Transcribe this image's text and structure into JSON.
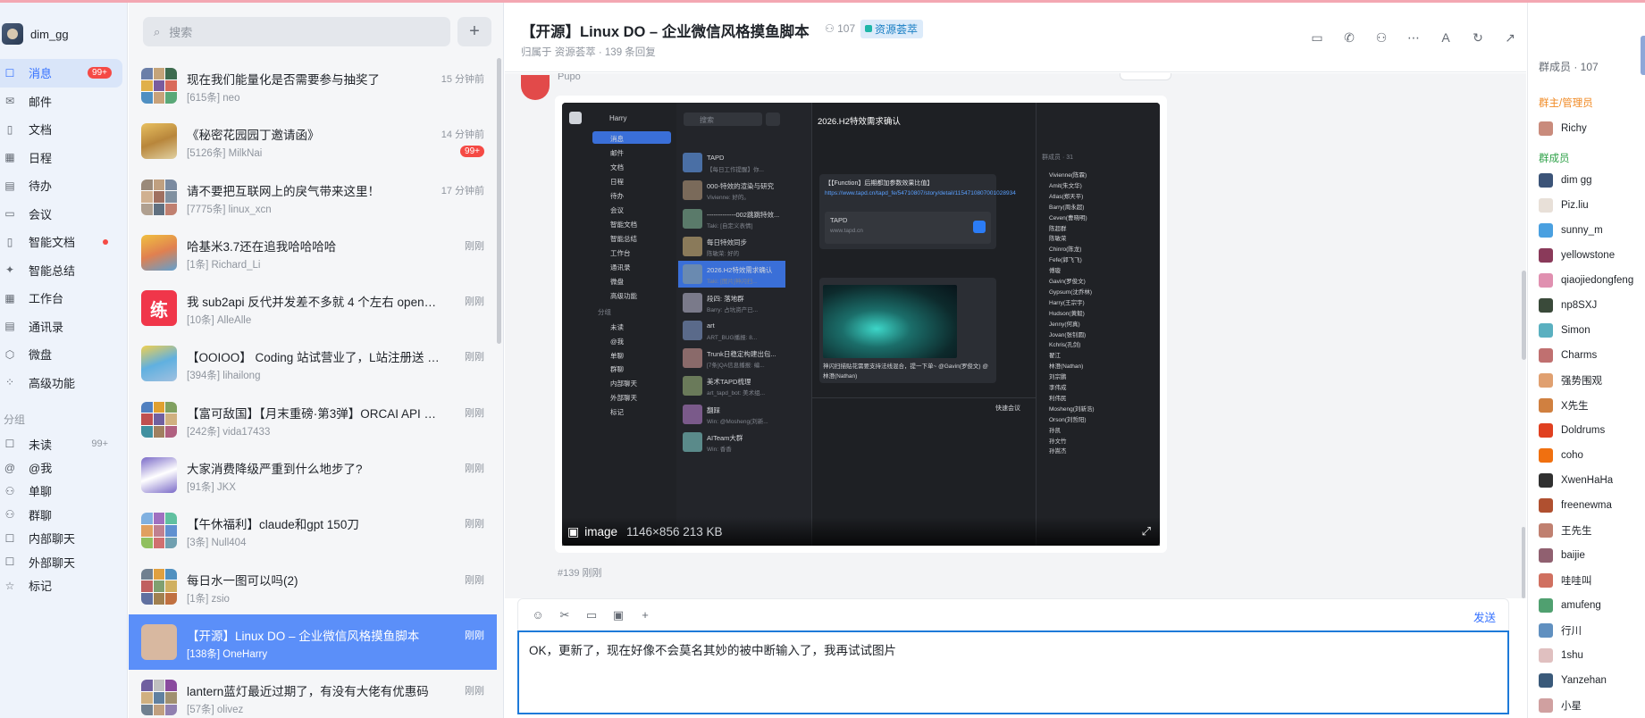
{
  "user": {
    "name": "dim_gg"
  },
  "nav": {
    "items": [
      {
        "label": "消息",
        "icon": "chat-icon",
        "glyph": "☐",
        "badge": "99+",
        "active": true
      },
      {
        "label": "邮件",
        "icon": "mail-icon",
        "glyph": "✉"
      },
      {
        "label": "文档",
        "icon": "doc-icon",
        "glyph": "▯"
      },
      {
        "label": "日程",
        "icon": "calendar-icon",
        "glyph": "▦"
      },
      {
        "label": "待办",
        "icon": "todo-icon",
        "glyph": "▤"
      },
      {
        "label": "会议",
        "icon": "meeting-icon",
        "glyph": "▭"
      },
      {
        "label": "智能文档",
        "icon": "smart-doc-icon",
        "glyph": "▯",
        "dot": true
      },
      {
        "label": "智能总结",
        "icon": "sparkle-icon",
        "glyph": "✦"
      },
      {
        "label": "工作台",
        "icon": "grid-icon",
        "glyph": "▦"
      },
      {
        "label": "通讯录",
        "icon": "contacts-icon",
        "glyph": "▤"
      },
      {
        "label": "微盘",
        "icon": "drive-icon",
        "glyph": "⬡"
      },
      {
        "label": "高级功能",
        "icon": "apps-icon",
        "glyph": "⁘"
      }
    ],
    "group_label": "分组",
    "groups": [
      {
        "label": "未读",
        "icon": "unread-icon",
        "glyph": "☐",
        "count": "99+"
      },
      {
        "label": "@我",
        "icon": "at-icon",
        "glyph": "@"
      },
      {
        "label": "单聊",
        "icon": "single-chat-icon",
        "glyph": "⚇"
      },
      {
        "label": "群聊",
        "icon": "group-chat-icon",
        "glyph": "⚇"
      },
      {
        "label": "内部聊天",
        "icon": "internal-chat-icon",
        "glyph": "☐"
      },
      {
        "label": "外部聊天",
        "icon": "external-chat-icon",
        "glyph": "☐"
      },
      {
        "label": "标记",
        "icon": "star-icon",
        "glyph": "☆"
      }
    ]
  },
  "search": {
    "placeholder": "搜索"
  },
  "chats": [
    {
      "title": "现在我们能量化是否需要参与抽奖了",
      "sub": "[615条] neo",
      "time": "15 分钟前"
    },
    {
      "title": "《秘密花园园丁邀请函》",
      "sub": "[5126条] MilkNai",
      "time": "14 分钟前",
      "badge": "99+"
    },
    {
      "title": "请不要把互联网上的戾气带来这里！",
      "sub": "[7775条] linux_xcn",
      "time": "17 分钟前"
    },
    {
      "title": "哈基米3.7还在追我哈哈哈哈",
      "sub": "[1条] Richard_Li",
      "time": "刚刚"
    },
    {
      "title": "我 sub2api 反代并发差不多就 4 个左右 openai 的官方并发是多少啊",
      "sub": "[10条] AlleAlle",
      "time": "刚刚",
      "avatar_text": "练"
    },
    {
      "title": "【OOIOO】 Coding 站试营业了，L站注册送 5$ 额度",
      "sub": "[394条] lihailong",
      "time": "刚刚"
    },
    {
      "title": "【富可敌国】【月末重磅·第3弹】ORCAI API 中转站开放",
      "sub": "[242条] vida17433",
      "time": "刚刚"
    },
    {
      "title": "大家消费降级严重到什么地步了?",
      "sub": "[91条] JKX",
      "time": "刚刚"
    },
    {
      "title": "【午休福利】claude和gpt 150刀",
      "sub": "[3条] Null404",
      "time": "刚刚"
    },
    {
      "title": "每日水一图可以吗(2)",
      "sub": "[1条] zsio",
      "time": "刚刚"
    },
    {
      "title": "【开源】Linux DO – 企业微信风格摸鱼脚本",
      "sub": "[138条] OneHarry",
      "time": "刚刚",
      "active": true
    },
    {
      "title": "lantern蓝灯最近过期了，有没有大佬有优惠码",
      "sub": "[57条] olivez",
      "time": "刚刚"
    }
  ],
  "header": {
    "title": "【开源】Linux DO – 企业微信风格摸鱼脚本",
    "member_count": "107",
    "tag": "资源荟萃",
    "subtitle": "归属于 资源荟萃 · 139 条回复"
  },
  "message": {
    "sender": "Pupo",
    "image_caption": "image",
    "image_meta": "1146×856 213 KB",
    "meta": "#139   刚刚"
  },
  "inner": {
    "user": "Harry",
    "search": "搜索",
    "nav": [
      "消息",
      "邮件",
      "文档",
      "日程",
      "待办",
      "会议",
      "智能文档",
      "智能总结",
      "工作台",
      "通讯录",
      "微盘",
      "高级功能"
    ],
    "group": "分组",
    "groups": [
      "未读",
      "@我",
      "单聊",
      "群聊",
      "内部聊天",
      "外部聊天",
      "标记"
    ],
    "chats": [
      {
        "t": "TAPD",
        "s": "【每日工作提醒】你..."
      },
      {
        "t": "000-特效的渲染与研究",
        "s": "Vivienne: 好的。"
      },
      {
        "t": "-------------002跳跳特效...",
        "s": "Taki: [自定义表情]"
      },
      {
        "t": "每日特效同步",
        "s": "陈敏荣: 好的"
      },
      {
        "t": "2026.H2特效需求确认",
        "s": "Taki: [图片]神闪扫..."
      },
      {
        "t": "段四: 落地群",
        "s": "Barry: 占坑资产已..."
      },
      {
        "t": "art",
        "s": "ART_BUG播报: 8..."
      },
      {
        "t": "Trunk日稳定构建出包...",
        "s": "[7条]QA信息播报: 编..."
      },
      {
        "t": "美术TAPD梳理",
        "s": "art_tapd_bot: 美术组..."
      },
      {
        "t": "翻踩",
        "s": "Win: @Mosheng(刘新..."
      },
      {
        "t": "AITeam大群",
        "s": "Win: 香香"
      }
    ],
    "chat_title": "2026.H2特效需求确认",
    "card_title": "【【Function】后期都加参数效果比值】",
    "card_link": "https://www.tapd.cn/tapd_fe/54710807/story/detail/1154710807001028934",
    "card_app": "TAPD",
    "card_domain": "www.tapd.cn",
    "photo_caption": "神闪扫描贴花需要支持法线混合，提一下单~ @Gavin(罗俊文) @林澄(Nathan)",
    "quick_meeting": "快速会议",
    "members_hdr": "群成员 · 31",
    "members": [
      "Vivienne(陈霖)",
      "Amit(朱文华)",
      "Atlas(郑天平)",
      "Barry(周永超)",
      "Ceven(曹晓明)",
      "陈超群",
      "陈敏荣",
      "Chinro(陈龙)",
      "Fefe(郭飞飞)",
      "傅璇",
      "Gavin(罗俊文)",
      "Gypsum(沈乔林)",
      "Harry(王宗宇)",
      "Hudson(黄毅)",
      "Jenny(何真)",
      "Jovan(张钊圆)",
      "Kchris(孔剑)",
      "翟江",
      "林澄(Nathan)",
      "刘宗鹏",
      "李伟成",
      "利伟民",
      "Mosheng(刘新浩)",
      "Orson(刘哲阳)",
      "孙凯",
      "孙文竹",
      "孙嵩杰"
    ]
  },
  "composer": {
    "send": "发送",
    "text": "OK，更新了，现在好像不会莫名其妙的被中断输入了，我再试试图片"
  },
  "members": {
    "header": "群成员 · 107",
    "owner_label": "群主/管理员",
    "owner": "Richy",
    "section_label": "群成员",
    "list": [
      "dim gg",
      "Piz.liu",
      "sunny_m",
      "yellowstone",
      "qiaojiedongfeng",
      "np8SXJ",
      "Simon",
      "Charms",
      "强势围观",
      "X先生",
      "Doldrums",
      "coho",
      "XwenHaHa",
      "freenewma",
      "王先生",
      "baijie",
      "哇哇叫",
      "amufeng",
      "行川",
      "1shu",
      "Yanzehan",
      "小星"
    ]
  },
  "colors": {
    "accent": "#3370ff",
    "active_item": "#5b8ff9",
    "badge": "#f54a45",
    "owner_label": "#f08a24",
    "member_label": "#2ea148"
  }
}
